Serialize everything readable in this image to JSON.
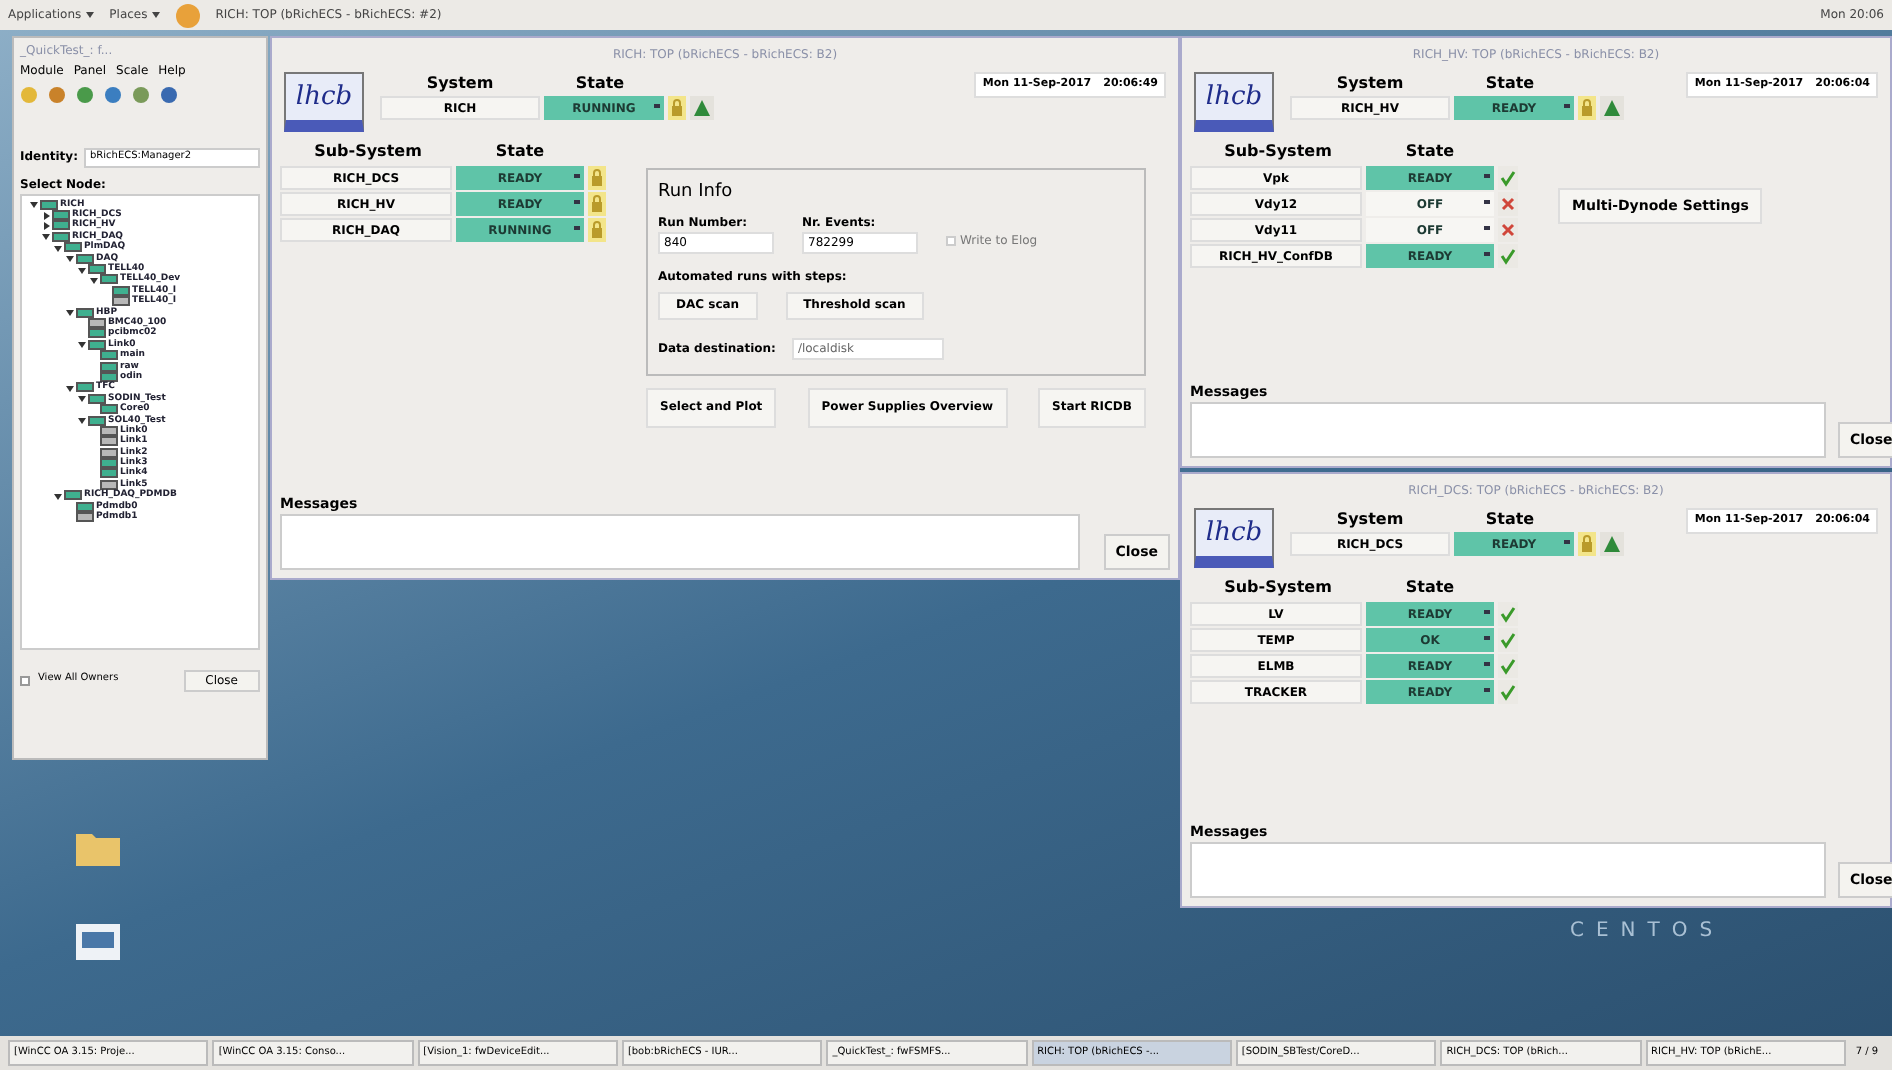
{
  "top_bar": {
    "menus": [
      "Applications",
      "Places"
    ],
    "active_window": "RICH: TOP (bRichECS - bRichECS: #2)",
    "clock": "Mon 20:06"
  },
  "tree_window": {
    "title": "_QuickTest_: f...",
    "menus": [
      "Module",
      "Panel",
      "Scale",
      "Help"
    ],
    "identity_label": "Identity:",
    "identity_value": "bRichECS:Manager2",
    "select_label": "Select Node:",
    "tree": [
      {
        "label": "RICH",
        "color": "#3fb08f",
        "expanded": true,
        "children": [
          {
            "label": "RICH_DCS",
            "color": "#3fb08f",
            "expanded": false
          },
          {
            "label": "RICH_HV",
            "color": "#3fb08f",
            "expanded": false
          },
          {
            "label": "RICH_DAQ",
            "color": "#3fb08f",
            "expanded": true,
            "children": [
              {
                "label": "PlmDAQ",
                "color": "#3fb08f",
                "expanded": true,
                "children": [
                  {
                    "label": "DAQ",
                    "color": "#3fb08f",
                    "expanded": true,
                    "children": [
                      {
                        "label": "TELL40",
                        "color": "#3fb08f",
                        "expanded": true,
                        "children": [
                          {
                            "label": "TELL40_Dev",
                            "color": "#3fb08f",
                            "expanded": true,
                            "children": [
                              {
                                "label": "TELL40_I",
                                "color": "#3fb08f"
                              },
                              {
                                "label": "TELL40_I",
                                "color": "#b8b8b8"
                              }
                            ]
                          }
                        ]
                      }
                    ]
                  },
                  {
                    "label": "HBP",
                    "color": "#3fb08f",
                    "expanded": true,
                    "children": [
                      {
                        "label": "BMC40_100",
                        "color": "#b8b8b8"
                      },
                      {
                        "label": "pcibmc02",
                        "color": "#3fb08f"
                      },
                      {
                        "label": "Link0",
                        "color": "#3fb08f",
                        "expanded": true,
                        "children": [
                          {
                            "label": "main",
                            "color": "#3fb08f"
                          },
                          {
                            "label": "raw",
                            "color": "#3fb08f"
                          },
                          {
                            "label": "odin",
                            "color": "#3fb08f"
                          }
                        ]
                      }
                    ]
                  },
                  {
                    "label": "TFC",
                    "color": "#3fb08f",
                    "expanded": true,
                    "children": [
                      {
                        "label": "SODIN_Test",
                        "color": "#3fb08f",
                        "expanded": true,
                        "children": [
                          {
                            "label": "Core0",
                            "color": "#3fb08f"
                          }
                        ]
                      },
                      {
                        "label": "SOL40_Test",
                        "color": "#3fb08f",
                        "expanded": true,
                        "children": [
                          {
                            "label": "Link0",
                            "color": "#b8b8b8"
                          },
                          {
                            "label": "Link1",
                            "color": "#b8b8b8"
                          },
                          {
                            "label": "Link2",
                            "color": "#b8b8b8"
                          },
                          {
                            "label": "Link3",
                            "color": "#3fb08f"
                          },
                          {
                            "label": "Link4",
                            "color": "#3fb08f"
                          },
                          {
                            "label": "Link5",
                            "color": "#b8b8b8"
                          }
                        ]
                      }
                    ]
                  }
                ]
              },
              {
                "label": "RICH_DAQ_PDMDB",
                "color": "#3fb08f",
                "expanded": true,
                "children": [
                  {
                    "label": "Pdmdb0",
                    "color": "#3fb08f"
                  },
                  {
                    "label": "Pdmdb1",
                    "color": "#b8b8b8"
                  }
                ]
              }
            ]
          }
        ]
      }
    ],
    "view_all_owners": {
      "label": "View All Owners",
      "checked": false
    },
    "close": "Close"
  },
  "main_window": {
    "title": "RICH: TOP (bRichECS - bRichECS: B2)",
    "logo": "lhcb",
    "date": "Mon 11-Sep-2017",
    "time": "20:06:49",
    "system_header": "System",
    "state_header": "State",
    "system": {
      "name": "RICH",
      "state": "RUNNING",
      "color": "#5fc4a8"
    },
    "subsystem_header": "Sub-System",
    "substate_header": "State",
    "subsystems": [
      {
        "name": "RICH_DCS",
        "state": "READY",
        "color": "#5fc4a8",
        "kind": "lock"
      },
      {
        "name": "RICH_HV",
        "state": "READY",
        "color": "#5fc4a8",
        "kind": "lock"
      },
      {
        "name": "RICH_DAQ",
        "state": "RUNNING",
        "color": "#5fc4a8",
        "kind": "lock"
      }
    ],
    "run_info": {
      "title": "Run Info",
      "run_number_label": "Run Number:",
      "run_number": "840",
      "events_label": "Nr. Events:",
      "events": "782299",
      "elog": {
        "label": "Write to Elog",
        "checked": false
      },
      "automated_label": "Automated runs with steps:",
      "scan_buttons": [
        "DAC scan",
        "Threshold scan"
      ],
      "destination_label": "Data destination:",
      "destination": "/localdisk"
    },
    "buttons": [
      "Select and Plot",
      "Power Supplies Overview",
      "Start RICDB"
    ],
    "messages_label": "Messages",
    "close": "Close"
  },
  "hv_window": {
    "title": "RICH_HV: TOP (bRichECS - bRichECS: B2)",
    "logo": "lhcb",
    "date": "Mon 11-Sep-2017",
    "time": "20:06:04",
    "system_header": "System",
    "state_header": "State",
    "system": {
      "name": "RICH_HV",
      "state": "READY",
      "color": "#5fc4a8"
    },
    "subsystem_header": "Sub-System",
    "substate_header": "State",
    "subsystems": [
      {
        "name": "Vpk",
        "state": "READY",
        "color": "#5fc4a8",
        "kind": "check"
      },
      {
        "name": "Vdy12",
        "state": "OFF",
        "color": "#f7f6f3",
        "kind": "cross"
      },
      {
        "name": "Vdy11",
        "state": "OFF",
        "color": "#f7f6f3",
        "kind": "cross"
      },
      {
        "name": "RICH_HV_ConfDB",
        "state": "READY",
        "color": "#5fc4a8",
        "kind": "check"
      }
    ],
    "settings_button": "Multi-Dynode Settings",
    "messages_label": "Messages",
    "close": "Close"
  },
  "dcs_window": {
    "title": "RICH_DCS: TOP (bRichECS - bRichECS: B2)",
    "logo": "lhcb",
    "date": "Mon 11-Sep-2017",
    "time": "20:06:04",
    "system_header": "System",
    "state_header": "State",
    "system": {
      "name": "RICH_DCS",
      "state": "READY",
      "color": "#5fc4a8"
    },
    "subsystem_header": "Sub-System",
    "substate_header": "State",
    "subsystems": [
      {
        "name": "LV",
        "state": "READY",
        "color": "#5fc4a8",
        "kind": "check"
      },
      {
        "name": "TEMP",
        "state": "OK",
        "color": "#5fc4a8",
        "kind": "check"
      },
      {
        "name": "ELMB",
        "state": "READY",
        "color": "#5fc4a8",
        "kind": "check"
      },
      {
        "name": "TRACKER",
        "state": "READY",
        "color": "#5fc4a8",
        "kind": "check"
      }
    ],
    "messages_label": "Messages",
    "close": "Close"
  },
  "desktop": {
    "wallpaper_text": "CENTOS"
  },
  "taskbar": {
    "items": [
      {
        "label": "[WinCC OA 3.15: Proje...",
        "selected": false
      },
      {
        "label": "[WinCC OA 3.15: Conso...",
        "selected": false
      },
      {
        "label": "[Vision_1: fwDeviceEdit...",
        "selected": false
      },
      {
        "label": "[bob:bRichECS - IUR...",
        "selected": false
      },
      {
        "label": "_QuickTest_: fwFSMFS...",
        "selected": false
      },
      {
        "label": "RICH: TOP (bRichECS -...",
        "selected": true
      },
      {
        "label": "[SODIN_SBTest/CoreD...",
        "selected": false
      },
      {
        "label": "RICH_DCS: TOP (bRich...",
        "selected": false
      },
      {
        "label": "RICH_HV: TOP (bRichE...",
        "selected": false
      }
    ],
    "workspace": "7 / 9"
  }
}
